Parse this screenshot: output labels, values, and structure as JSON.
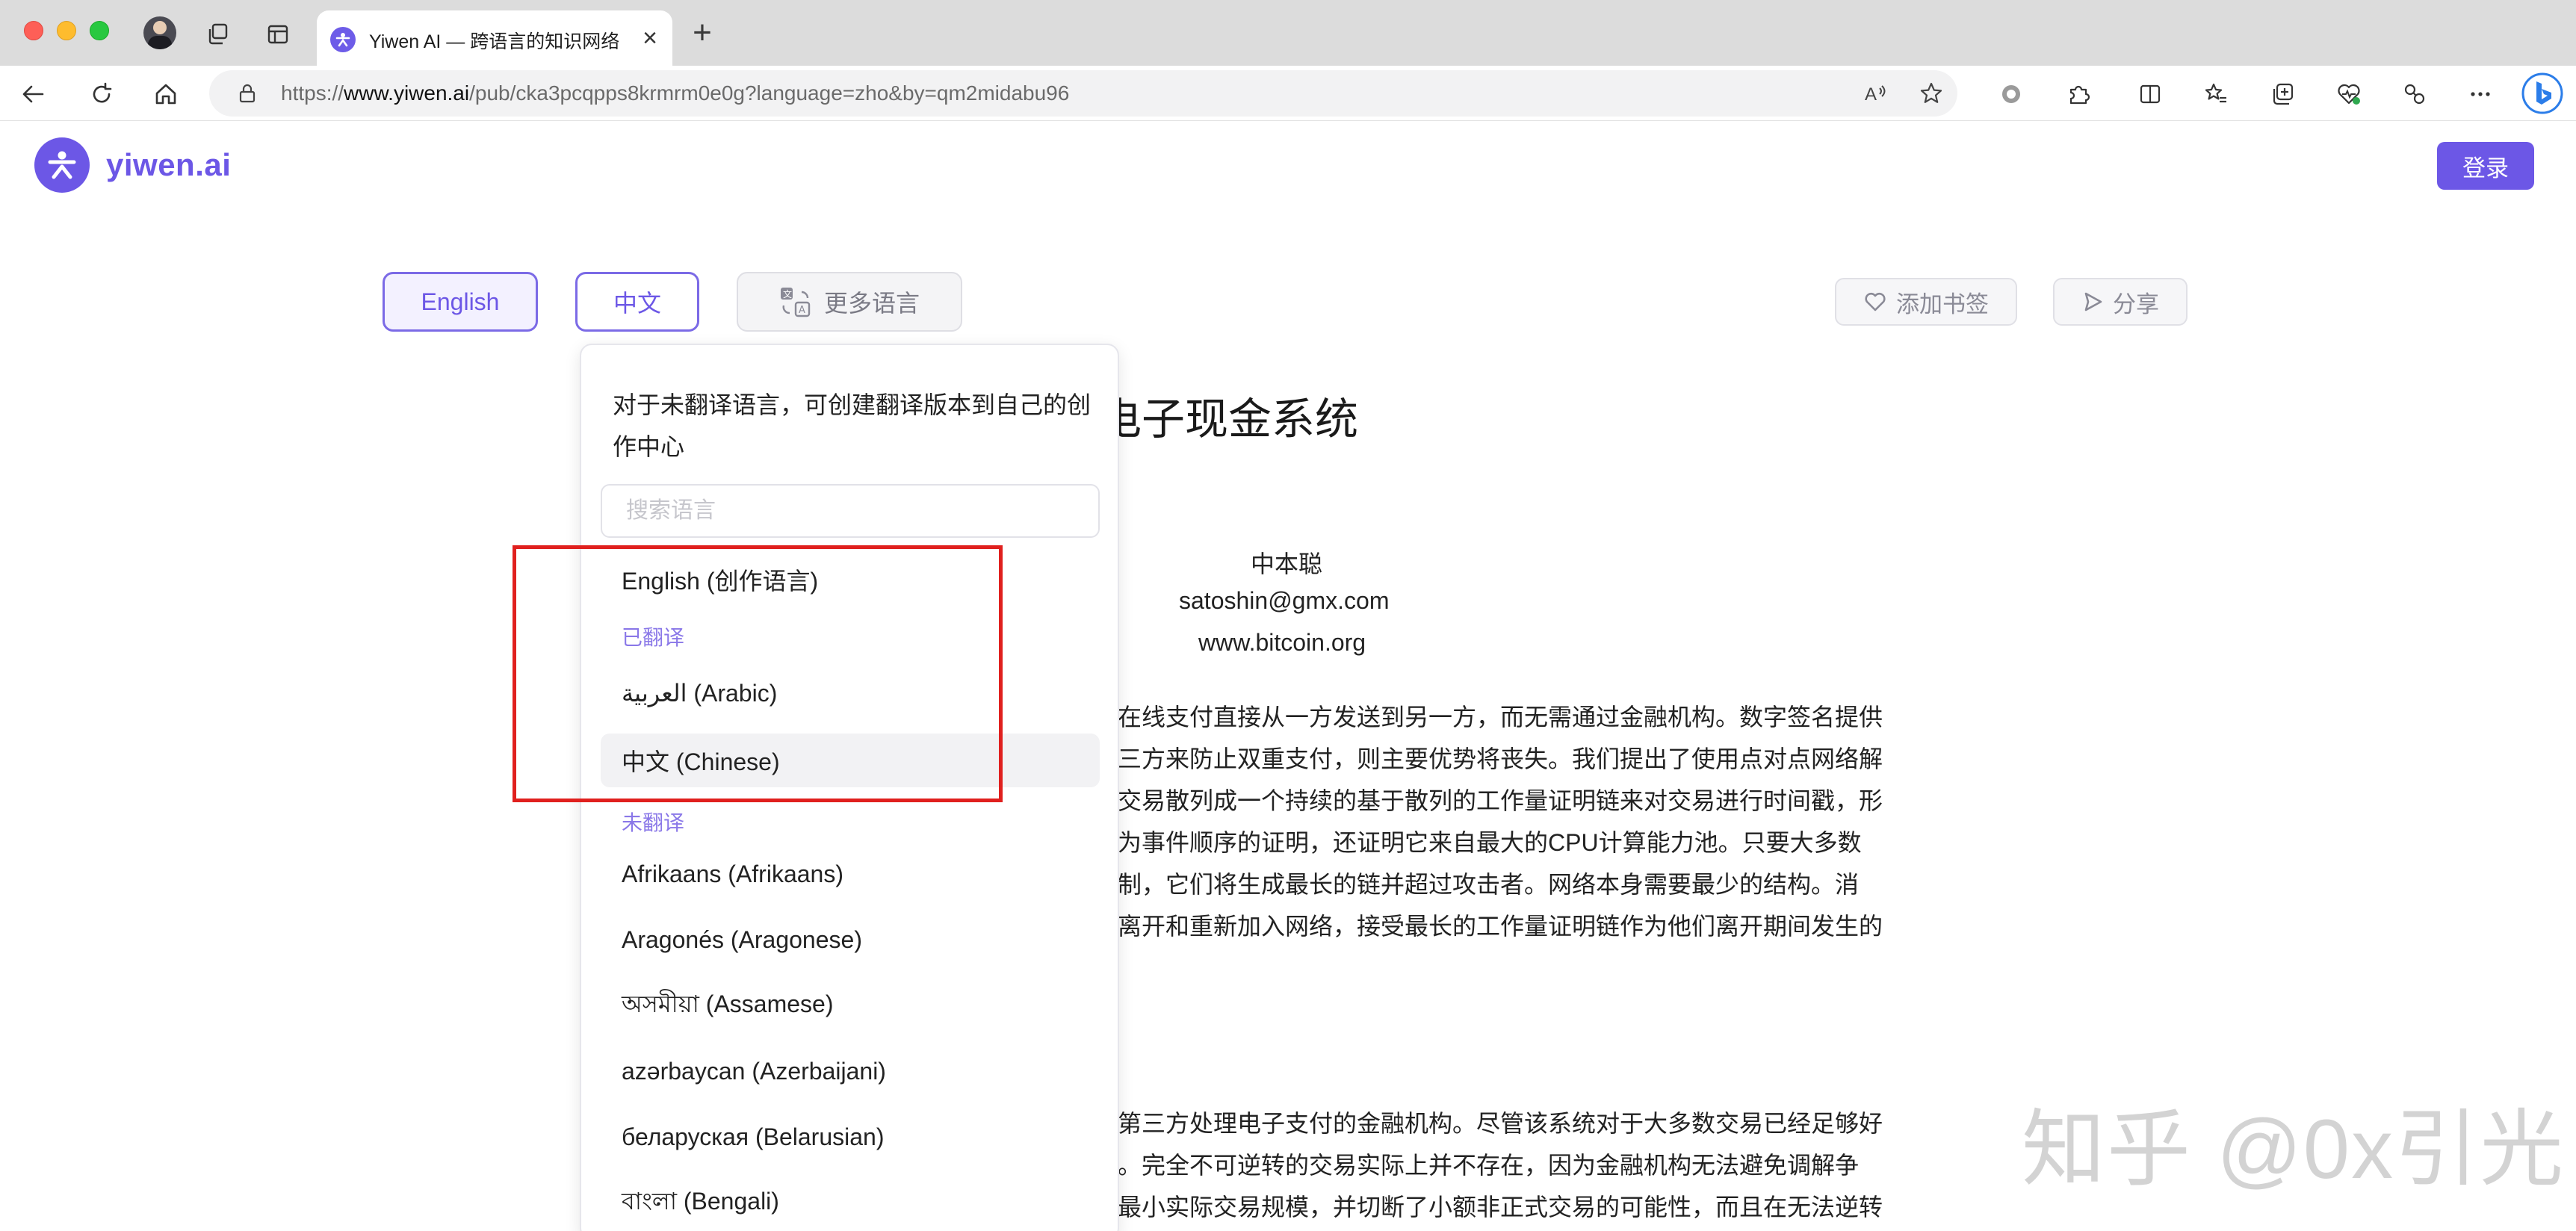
{
  "browser": {
    "tab_title": "Yiwen AI — 跨语言的知识网络",
    "url_prefix": "https://",
    "url_domain": "www.yiwen.ai",
    "url_path": "/pub/cka3pcqpps8krmrm0e0g?language=zho&by=qm2midabu96"
  },
  "header": {
    "brand": "yiwen.ai",
    "login": "登录"
  },
  "lang_bar": {
    "english": "English",
    "chinese": "中文",
    "more": "更多语言",
    "bookmark": "添加书签",
    "share": "分享"
  },
  "article": {
    "title_visible": "电子现金系统",
    "author": "中本聪",
    "email": "satoshin@gmx.com",
    "site": "www.bitcoin.org",
    "para1": [
      "在线支付直接从一方发送到另一方，而无需通过金融机构。数字签名提供",
      "三方来防止双重支付，则主要优势将丧失。我们提出了使用点对点网络解",
      "交易散列成一个持续的基于散列的工作量证明链来对交易进行时间戳，形",
      "为事件顺序的证明，还证明它来自最大的CPU计算能力池。只要大多数",
      "制，它们将生成最长的链并超过攻击者。网络本身需要最少的结构。消",
      "离开和重新加入网络，接受最长的工作量证明链作为他们离开期间发生的"
    ],
    "para2": [
      "第三方处理电子支付的金融机构。尽管该系统对于大多数交易已经足够好",
      "。完全不可逆转的交易实际上并不存在，因为金融机构无法避免调解争",
      "最小实际交易规模，并切断了小额非正式交易的可能性，而且在无法逆转"
    ]
  },
  "dropdown": {
    "hint": "对于未翻译语言，可创建翻译版本到自己的创作中心",
    "search_placeholder": "搜索语言",
    "source_language": "English (创作语言)",
    "translated_label": "已翻译",
    "translated": [
      "العربية (Arabic)",
      "中文 (Chinese)"
    ],
    "untranslated_label": "未翻译",
    "untranslated": [
      "Afrikaans (Afrikaans)",
      "Aragonés (Aragonese)",
      "অসমীয়া (Assamese)",
      "azərbaycan (Azerbaijani)",
      "беларуская (Belarusian)",
      "বাংলা (Bengali)"
    ]
  },
  "watermark": "知乎 @0x引光",
  "colors": {
    "brand": "#6c57e6",
    "annotation": "#e0201e"
  }
}
